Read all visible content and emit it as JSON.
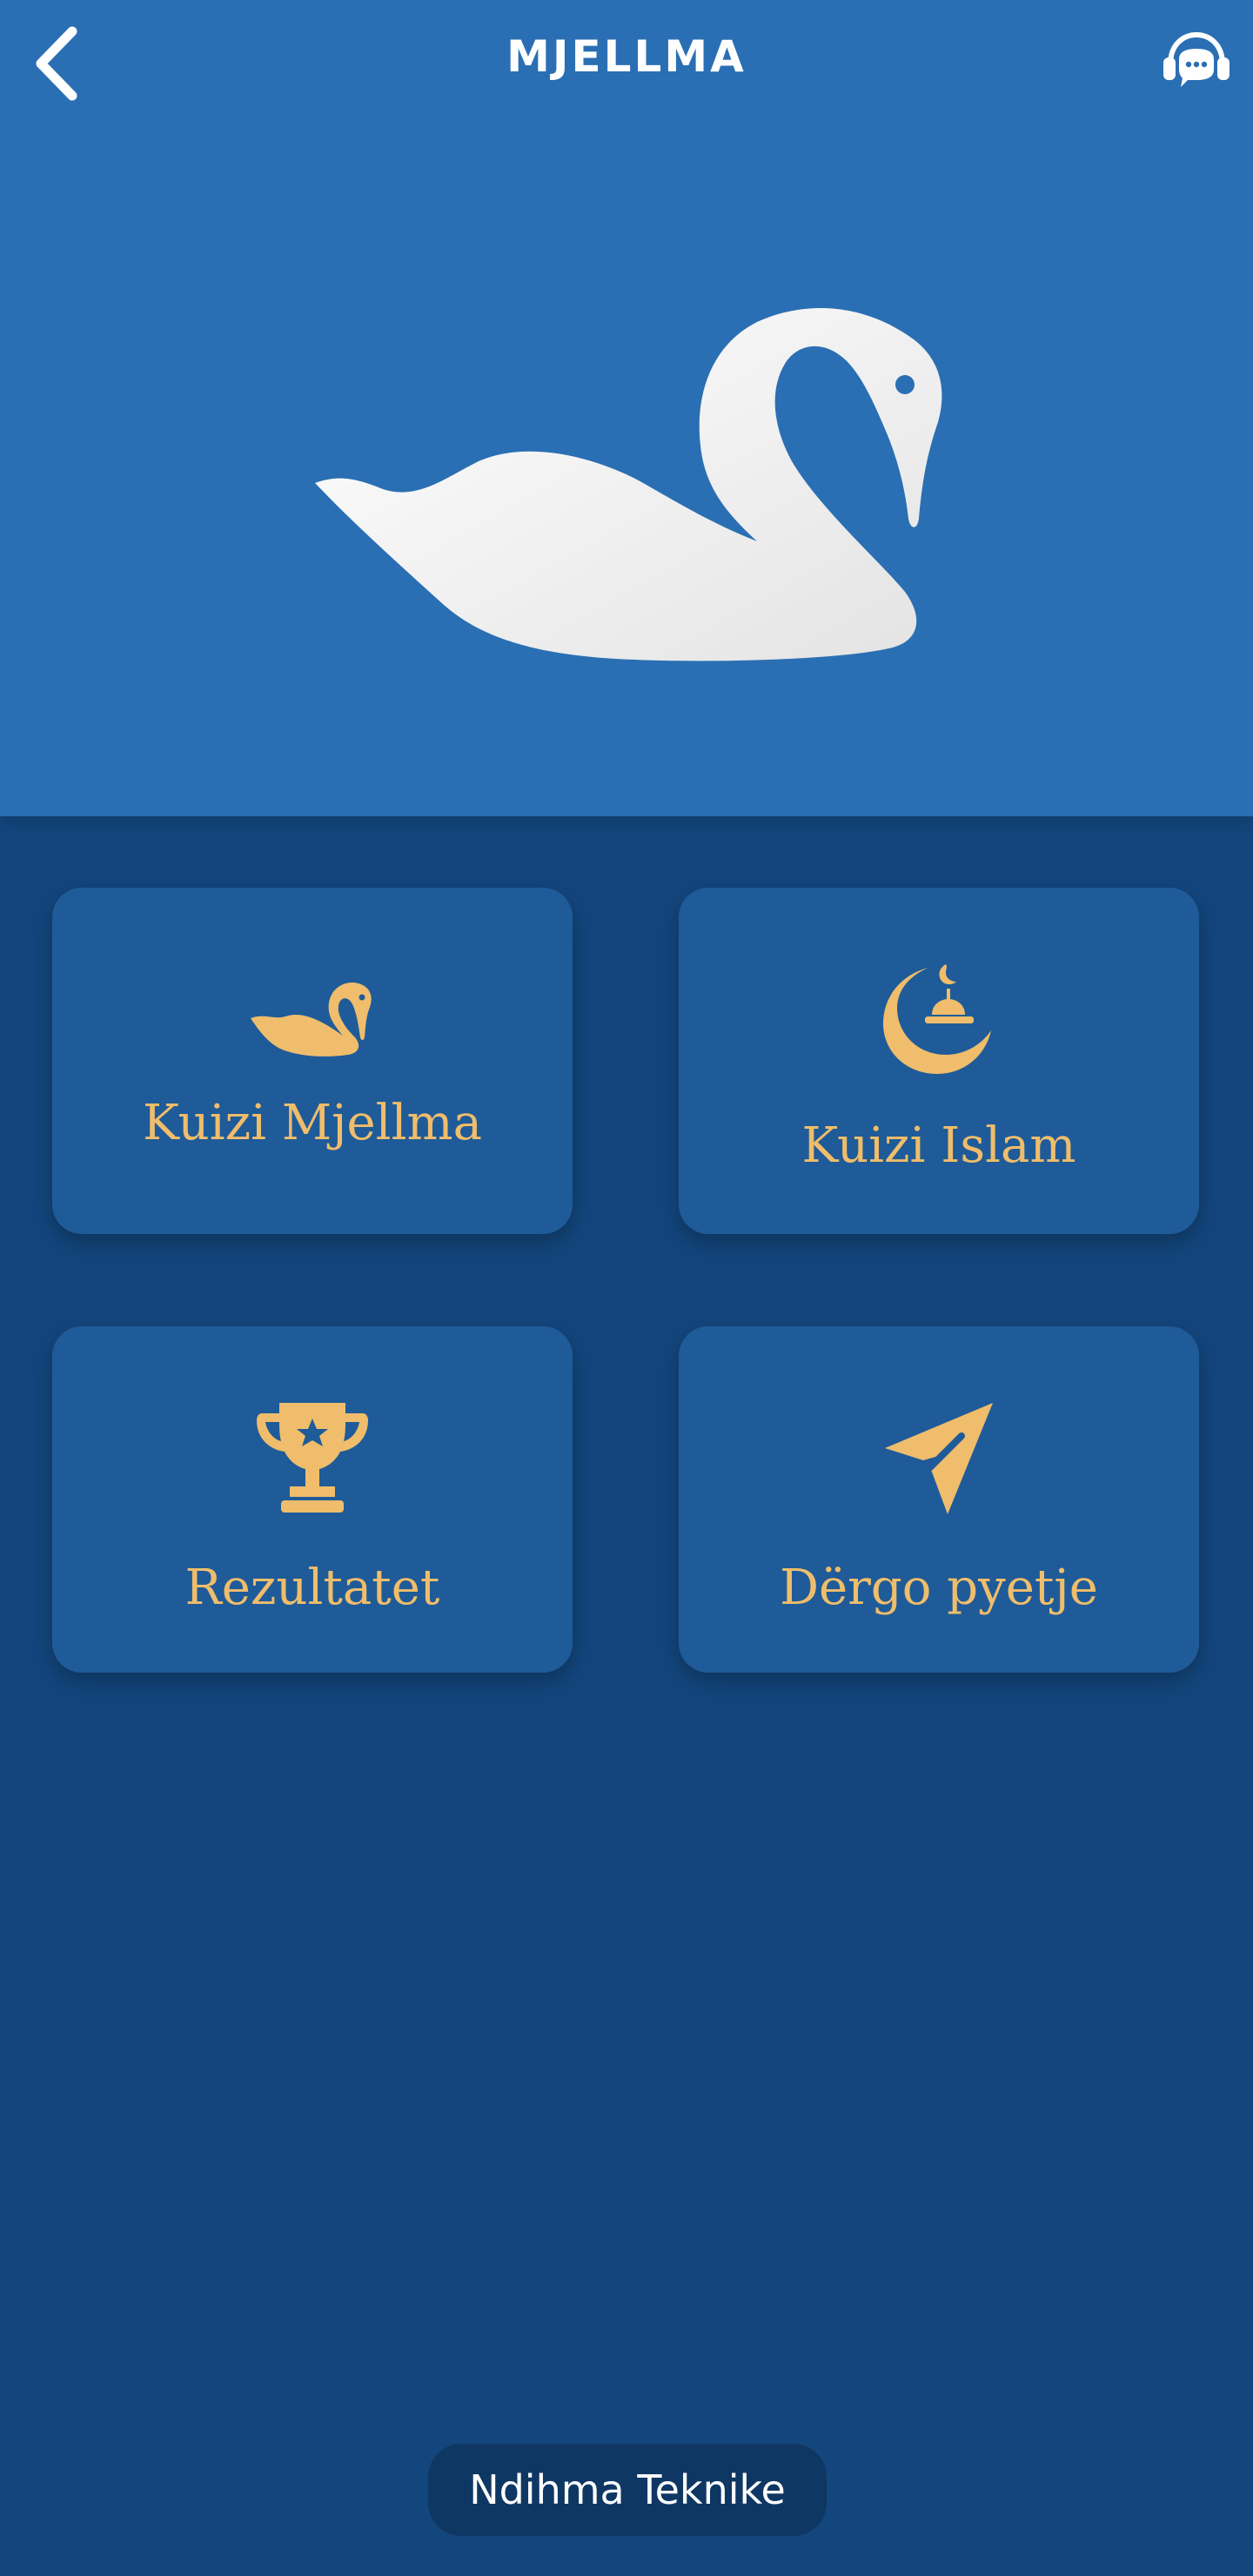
{
  "app": {
    "title": "MJELLMA"
  },
  "header": {
    "back_icon": "chevron-left-icon",
    "support_icon": "headset-chat-icon",
    "hero_image": "swan-logo"
  },
  "menu": {
    "tiles": [
      {
        "label": "Kuizi Mjellma",
        "icon": "swan-icon"
      },
      {
        "label": "Kuizi Islam",
        "icon": "crescent-mosque-icon"
      },
      {
        "label": "Rezultatet",
        "icon": "trophy-icon"
      },
      {
        "label": "Dërgo pyetje",
        "icon": "send-icon"
      }
    ]
  },
  "footer": {
    "help_label": "Ndihma Teknike"
  },
  "colors": {
    "header_bg": "#2a6fb3",
    "page_bg": "#13467d",
    "tile_bg": "#1f5b98",
    "accent_gold": "#efbd6b",
    "help_bg": "#0f3764"
  }
}
